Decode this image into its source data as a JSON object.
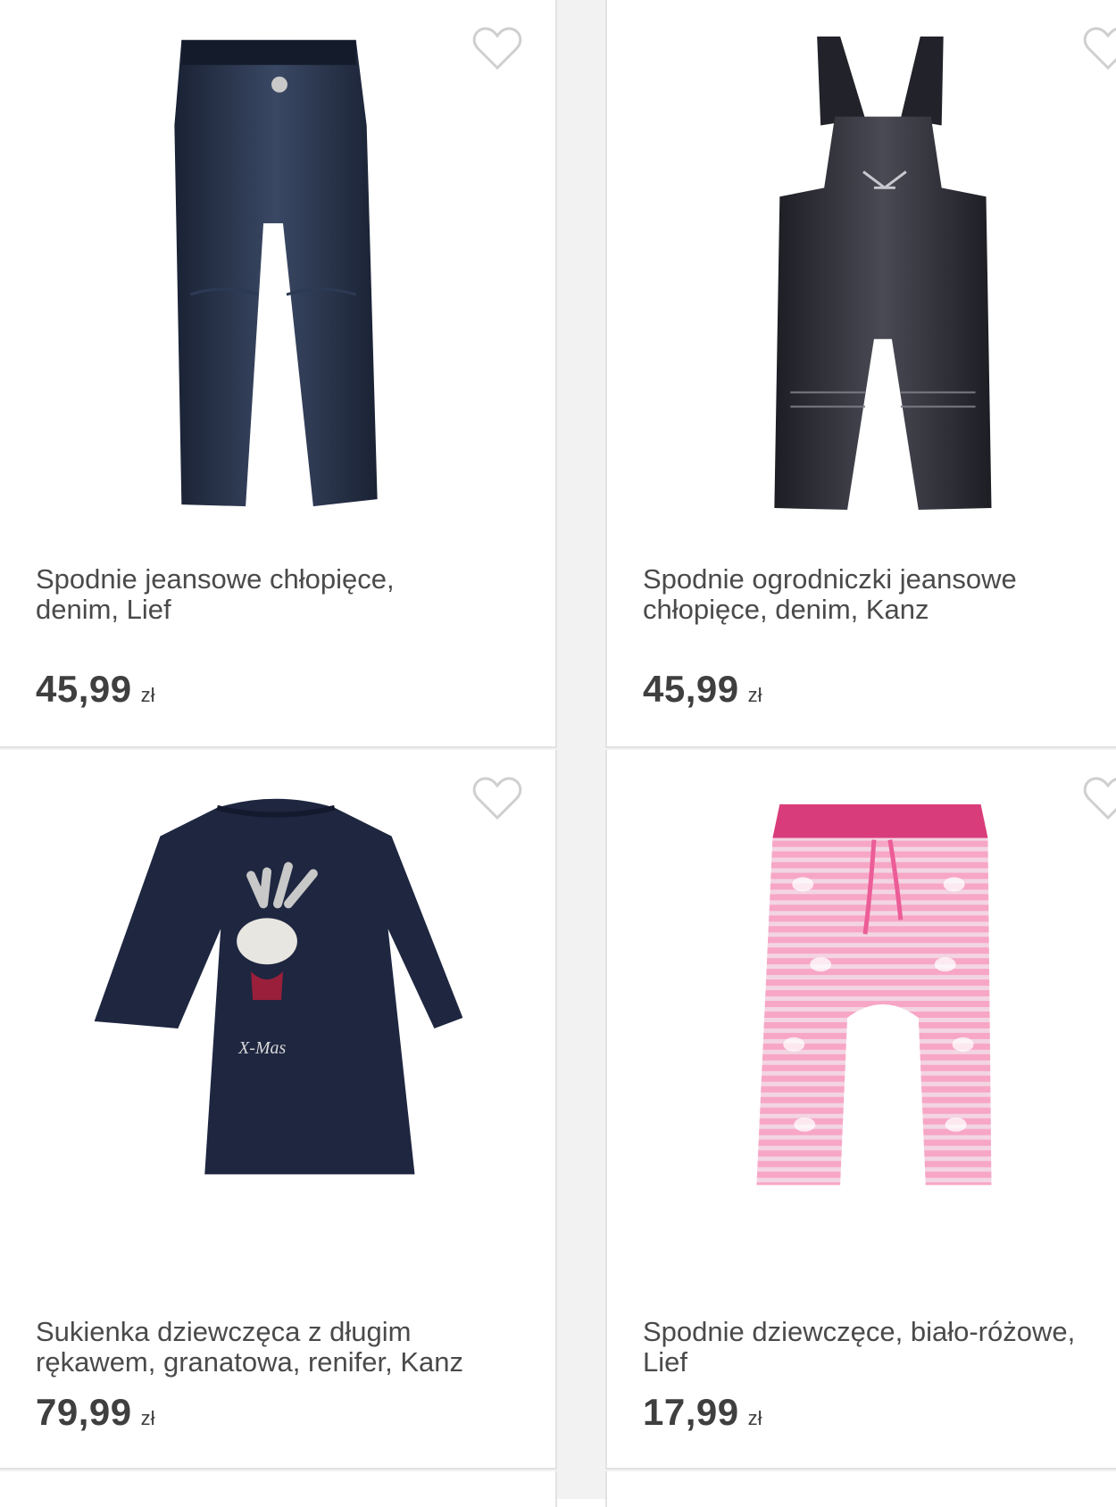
{
  "products": [
    {
      "name": "Spodnie jeansowe chłopięce,\ndenim, Lief",
      "price": "45,99",
      "currency": "zł"
    },
    {
      "name": "Spodnie ogrodniczki jeansowe\nchłopięce, denim, Kanz",
      "price": "45,99",
      "currency": "zł"
    },
    {
      "name": "Sukienka dziewczęca z długim\nrękawem, granatowa, renifer, Kanz",
      "price": "79,99",
      "currency": "zł"
    },
    {
      "name": "Spodnie dziewczęce, biało-różowe,\nLief",
      "price": "17,99",
      "currency": "zł"
    }
  ],
  "icons": {
    "favorite": "heart-outline-icon"
  },
  "colors": {
    "text": "#4a4a4a",
    "price": "#3f3f3f",
    "divider": "#e3e3e3",
    "denim": "#1c2538",
    "pink": "#e0508a"
  }
}
